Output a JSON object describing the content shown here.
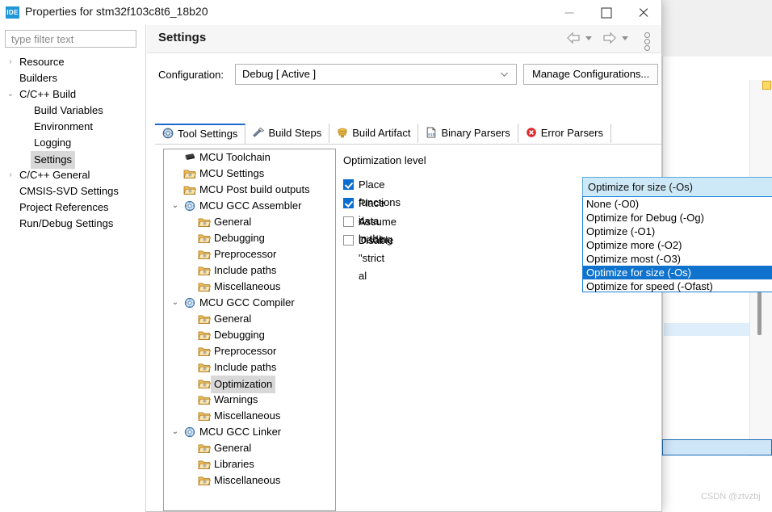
{
  "window": {
    "title": "Properties for stm32f103c8t6_18b20",
    "app_icon": "IDE",
    "minimize_label": "Minimize",
    "maximize_label": "Maximize",
    "close_label": "Close"
  },
  "left_pane": {
    "filter": {
      "placeholder": "type filter text",
      "value": ""
    },
    "tree": [
      {
        "label": "Resource",
        "indent": 0,
        "chevron": "›",
        "selected": false
      },
      {
        "label": "Builders",
        "indent": 0,
        "chevron": "",
        "selected": false
      },
      {
        "label": "C/C++ Build",
        "indent": 0,
        "chevron": "⌄",
        "selected": false
      },
      {
        "label": "Build Variables",
        "indent": 1,
        "chevron": "",
        "selected": false
      },
      {
        "label": "Environment",
        "indent": 1,
        "chevron": "",
        "selected": false
      },
      {
        "label": "Logging",
        "indent": 1,
        "chevron": "",
        "selected": false
      },
      {
        "label": "Settings",
        "indent": 1,
        "chevron": "",
        "selected": true
      },
      {
        "label": "C/C++ General",
        "indent": 0,
        "chevron": "›",
        "selected": false
      },
      {
        "label": "CMSIS-SVD Settings",
        "indent": 0,
        "chevron": "",
        "selected": false
      },
      {
        "label": "Project References",
        "indent": 0,
        "chevron": "",
        "selected": false
      },
      {
        "label": "Run/Debug Settings",
        "indent": 0,
        "chevron": "",
        "selected": false
      }
    ]
  },
  "settings": {
    "title": "Settings",
    "nav": {
      "back": "Back",
      "forward": "Forward",
      "menu": "View Menu"
    },
    "configuration": {
      "label": "Configuration:",
      "value": "Debug  [ Active ]",
      "manage_button": "Manage Configurations..."
    },
    "tabs": [
      {
        "label": "Tool Settings",
        "icon": "tool-settings-icon",
        "active": true
      },
      {
        "label": "Build Steps",
        "icon": "hammer-icon",
        "active": false
      },
      {
        "label": "Build Artifact",
        "icon": "artifact-icon",
        "active": false
      },
      {
        "label": "Binary Parsers",
        "icon": "binary-file-icon",
        "active": false
      },
      {
        "label": "Error Parsers",
        "icon": "error-icon",
        "active": false
      }
    ],
    "tool_tree": [
      {
        "label": "MCU Toolchain",
        "indent": 0,
        "chevron": "",
        "icon": "chip",
        "selected": false
      },
      {
        "label": "MCU Settings",
        "indent": 0,
        "chevron": "",
        "icon": "folder",
        "selected": false
      },
      {
        "label": "MCU Post build outputs",
        "indent": 0,
        "chevron": "",
        "icon": "folder",
        "selected": false
      },
      {
        "label": "MCU GCC Assembler",
        "indent": 0,
        "chevron": "⌄",
        "icon": "tool",
        "selected": false
      },
      {
        "label": "General",
        "indent": 1,
        "chevron": "",
        "icon": "folder",
        "selected": false
      },
      {
        "label": "Debugging",
        "indent": 1,
        "chevron": "",
        "icon": "folder",
        "selected": false
      },
      {
        "label": "Preprocessor",
        "indent": 1,
        "chevron": "",
        "icon": "folder",
        "selected": false
      },
      {
        "label": "Include paths",
        "indent": 1,
        "chevron": "",
        "icon": "folder",
        "selected": false
      },
      {
        "label": "Miscellaneous",
        "indent": 1,
        "chevron": "",
        "icon": "folder",
        "selected": false
      },
      {
        "label": "MCU GCC Compiler",
        "indent": 0,
        "chevron": "⌄",
        "icon": "tool",
        "selected": false
      },
      {
        "label": "General",
        "indent": 1,
        "chevron": "",
        "icon": "folder",
        "selected": false
      },
      {
        "label": "Debugging",
        "indent": 1,
        "chevron": "",
        "icon": "folder",
        "selected": false
      },
      {
        "label": "Preprocessor",
        "indent": 1,
        "chevron": "",
        "icon": "folder",
        "selected": false
      },
      {
        "label": "Include paths",
        "indent": 1,
        "chevron": "",
        "icon": "folder",
        "selected": false
      },
      {
        "label": "Optimization",
        "indent": 1,
        "chevron": "",
        "icon": "folder",
        "selected": true
      },
      {
        "label": "Warnings",
        "indent": 1,
        "chevron": "",
        "icon": "folder",
        "selected": false
      },
      {
        "label": "Miscellaneous",
        "indent": 1,
        "chevron": "",
        "icon": "folder",
        "selected": false
      },
      {
        "label": "MCU GCC Linker",
        "indent": 0,
        "chevron": "⌄",
        "icon": "tool",
        "selected": false
      },
      {
        "label": "General",
        "indent": 1,
        "chevron": "",
        "icon": "folder",
        "selected": false
      },
      {
        "label": "Libraries",
        "indent": 1,
        "chevron": "",
        "icon": "folder",
        "selected": false
      },
      {
        "label": "Miscellaneous",
        "indent": 1,
        "chevron": "",
        "icon": "folder",
        "selected": false
      }
    ],
    "options": {
      "optimization_level_label": "Optimization level",
      "checkboxes": [
        {
          "label": "Place functions i",
          "checked": true
        },
        {
          "label": "Place data in the",
          "checked": true
        },
        {
          "label": "Assume loading",
          "checked": false
        },
        {
          "label": "Disable \"strict al",
          "checked": false
        }
      ]
    },
    "optimization_combo": {
      "value": "Optimize for size (-Os)",
      "expanded": true,
      "options": [
        {
          "label": "None (-O0)",
          "selected": false
        },
        {
          "label": "Optimize for Debug (-Og)",
          "selected": false
        },
        {
          "label": "Optimize (-O1)",
          "selected": false
        },
        {
          "label": "Optimize more (-O2)",
          "selected": false
        },
        {
          "label": "Optimize most (-O3)",
          "selected": false
        },
        {
          "label": "Optimize for size (-Os)",
          "selected": true
        },
        {
          "label": "Optimize for speed (-Ofast)",
          "selected": false
        }
      ]
    }
  },
  "watermark": "CSDN @ztvzbj",
  "colors": {
    "accent_blue": "#0f73cd",
    "combo_fill": "#cde8f6",
    "tab_active_underline": "#1b6ac9",
    "selection_gray": "#d8d8d8"
  }
}
